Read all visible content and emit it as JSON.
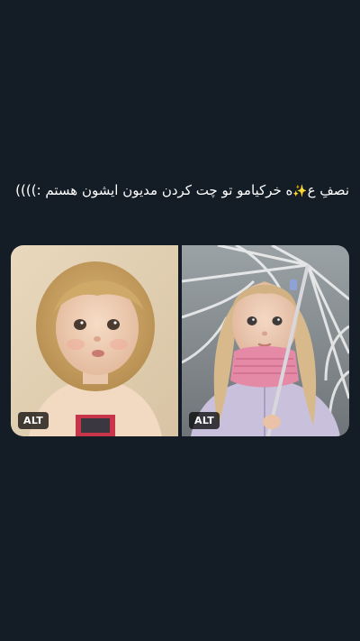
{
  "post": {
    "text_prefix": "نصفِ ع",
    "sparkle_icon": "sparkle-icon",
    "text_suffix": "ه خرکیامو تو چت کردن مدیون ایشون هستم :))))"
  },
  "media": [
    {
      "alt_label": "ALT"
    },
    {
      "alt_label": "ALT"
    }
  ],
  "colors": {
    "background": "#141d26",
    "text": "#ffffff",
    "badge_bg": "#000000"
  }
}
